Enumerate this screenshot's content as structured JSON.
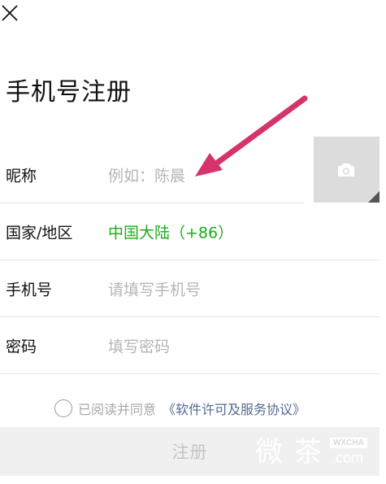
{
  "header": {
    "close_icon": "close-icon"
  },
  "page": {
    "title": "手机号注册"
  },
  "form": {
    "nickname": {
      "label": "昵称",
      "placeholder": "例如：陈晨"
    },
    "region": {
      "label": "国家/地区",
      "value": "中国大陆（+86）"
    },
    "phone": {
      "label": "手机号",
      "placeholder": "请填写手机号"
    },
    "password": {
      "label": "密码",
      "placeholder": "填写密码"
    }
  },
  "avatar": {
    "icon": "camera-icon"
  },
  "agreement": {
    "text": "已阅读并同意",
    "link": "《软件许可及服务协议》",
    "checked": false
  },
  "register_button": {
    "label": "注册"
  },
  "watermark": {
    "chars": [
      "微",
      "茶"
    ],
    "tag": "WXCHA",
    "domain": ".com"
  },
  "colors": {
    "accent_green": "#1aad19",
    "link_blue": "#576b95",
    "annotation_arrow": "#d6336c",
    "button_bg": "#f0f0f0"
  }
}
